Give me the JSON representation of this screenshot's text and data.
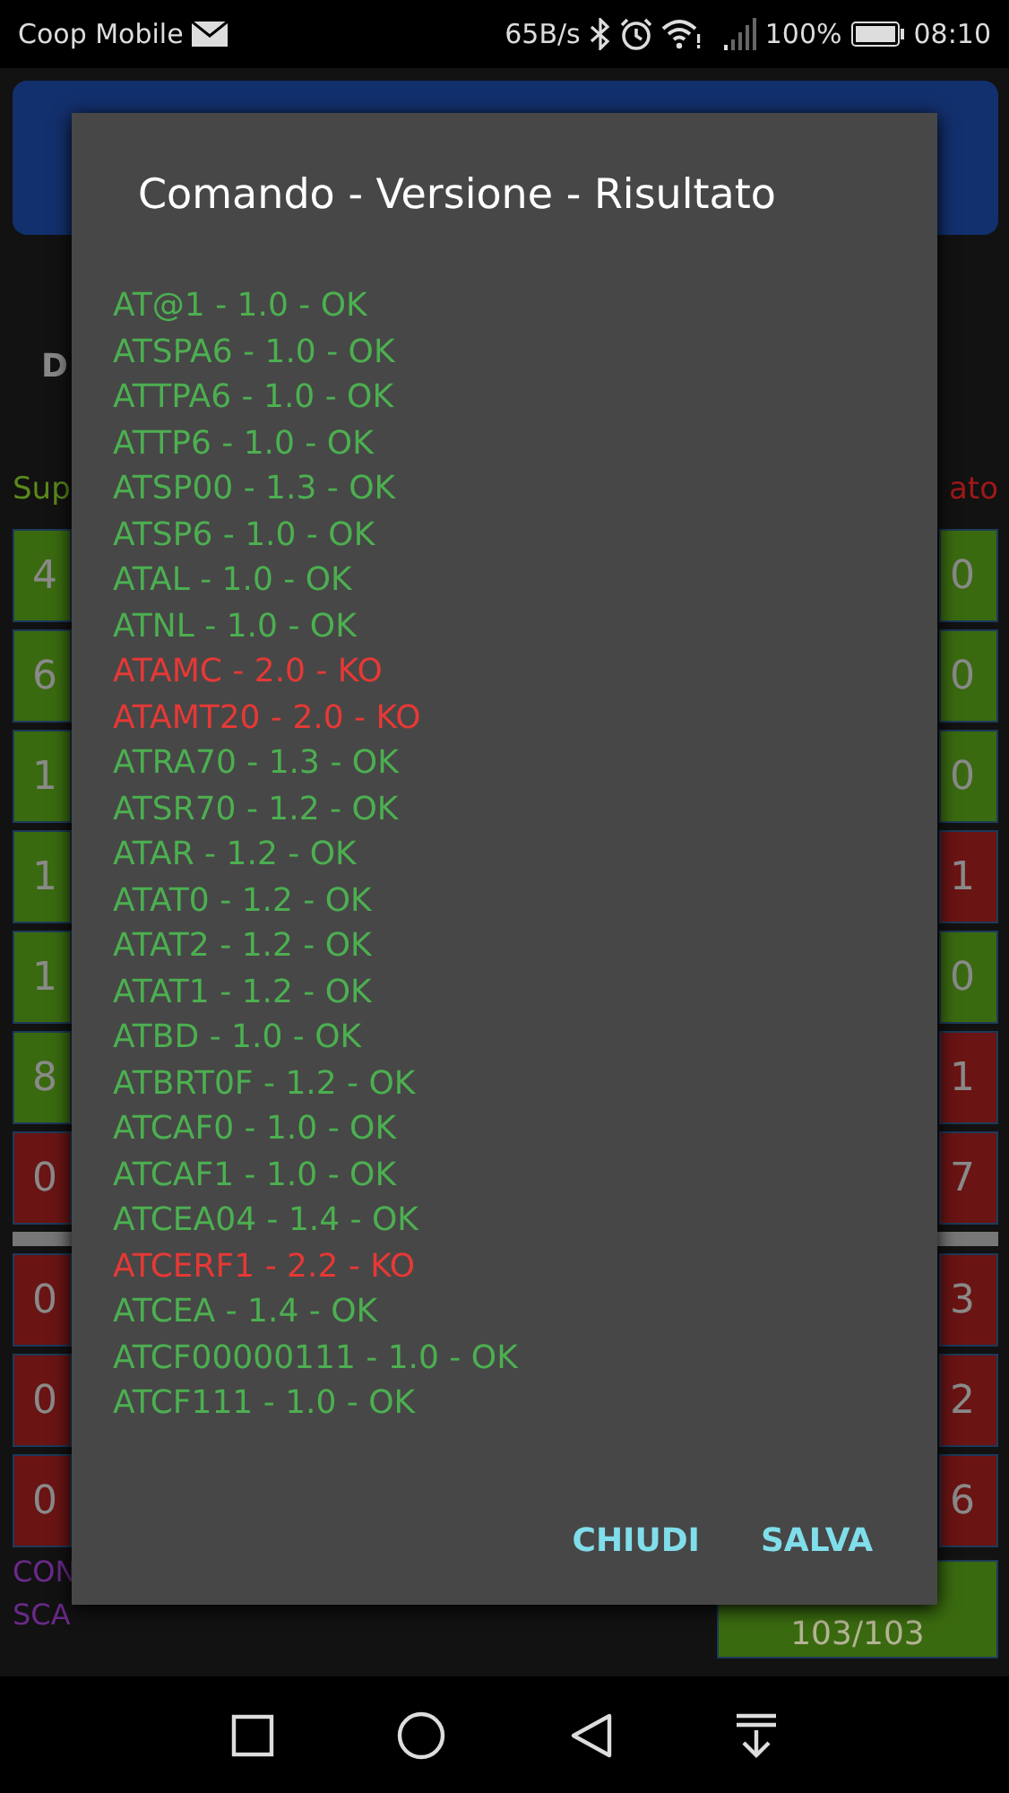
{
  "status_bar": {
    "carrier": "Coop Mobile",
    "speed": "65B/s",
    "battery": "100%",
    "time": "08:10"
  },
  "background": {
    "heading_left": "D",
    "label_left": "Sup",
    "label_right": "ato",
    "left_cells": [
      {
        "text": "4",
        "color": "#3a6a10"
      },
      {
        "text": "6",
        "color": "#3a6a10"
      },
      {
        "text": "1",
        "color": "#3a6a10"
      },
      {
        "text": "1",
        "color": "#3a6a10"
      },
      {
        "text": "1",
        "color": "#3a6a10"
      },
      {
        "text": "8",
        "color": "#3a6a10"
      },
      {
        "text": "0",
        "color": "#6a1414"
      },
      {
        "text": "0",
        "color": "#6a1414"
      },
      {
        "text": "0",
        "color": "#6a1414"
      },
      {
        "text": "0",
        "color": "#6a1414"
      }
    ],
    "right_cells": [
      {
        "text": "0",
        "color": "#3a6a10"
      },
      {
        "text": "0",
        "color": "#3a6a10"
      },
      {
        "text": "0",
        "color": "#3a6a10"
      },
      {
        "text": "1",
        "color": "#6a1414"
      },
      {
        "text": "0",
        "color": "#3a6a10"
      },
      {
        "text": "1",
        "color": "#6a1414"
      },
      {
        "text": "7",
        "color": "#6a1414"
      },
      {
        "text": "3",
        "color": "#6a1414"
      },
      {
        "text": "2",
        "color": "#6a1414"
      },
      {
        "text": "6",
        "color": "#6a1414"
      }
    ],
    "footer_lines": [
      "CON",
      "SCA"
    ],
    "counter": "103/103"
  },
  "dialog": {
    "title": "Comando - Versione - Risultato",
    "items": [
      {
        "text": "AT@1 - 1.0 - OK",
        "failed": false
      },
      {
        "text": "ATSPA6 - 1.0 - OK",
        "failed": false
      },
      {
        "text": "ATTPA6 - 1.0 - OK",
        "failed": false
      },
      {
        "text": "ATTP6 - 1.0 - OK",
        "failed": false
      },
      {
        "text": "ATSP00 - 1.3 - OK",
        "failed": false
      },
      {
        "text": "ATSP6 - 1.0 - OK",
        "failed": false
      },
      {
        "text": "ATAL - 1.0 - OK",
        "failed": false
      },
      {
        "text": "ATNL - 1.0 - OK",
        "failed": false
      },
      {
        "text": "ATAMC - 2.0 - KO",
        "failed": true
      },
      {
        "text": "ATAMT20 - 2.0 - KO",
        "failed": true
      },
      {
        "text": "ATRA70 - 1.3 - OK",
        "failed": false
      },
      {
        "text": "ATSR70 - 1.2 - OK",
        "failed": false
      },
      {
        "text": "ATAR - 1.2 - OK",
        "failed": false
      },
      {
        "text": "ATAT0 - 1.2 - OK",
        "failed": false
      },
      {
        "text": "ATAT2 - 1.2 - OK",
        "failed": false
      },
      {
        "text": "ATAT1 - 1.2 - OK",
        "failed": false
      },
      {
        "text": "ATBD - 1.0 - OK",
        "failed": false
      },
      {
        "text": "ATBRT0F - 1.2 - OK",
        "failed": false
      },
      {
        "text": "ATCAF0 - 1.0 - OK",
        "failed": false
      },
      {
        "text": "ATCAF1 - 1.0 - OK",
        "failed": false
      },
      {
        "text": "ATCEA04 - 1.4 - OK",
        "failed": false
      },
      {
        "text": "ATCERF1 - 2.2 - KO",
        "failed": true
      },
      {
        "text": "ATCEA - 1.4 - OK",
        "failed": false
      },
      {
        "text": "ATCF00000111 - 1.0 - OK",
        "failed": false
      },
      {
        "text": "ATCF111 - 1.0 - OK",
        "failed": false
      }
    ],
    "buttons": [
      "CHIUDI",
      "SALVA"
    ]
  }
}
